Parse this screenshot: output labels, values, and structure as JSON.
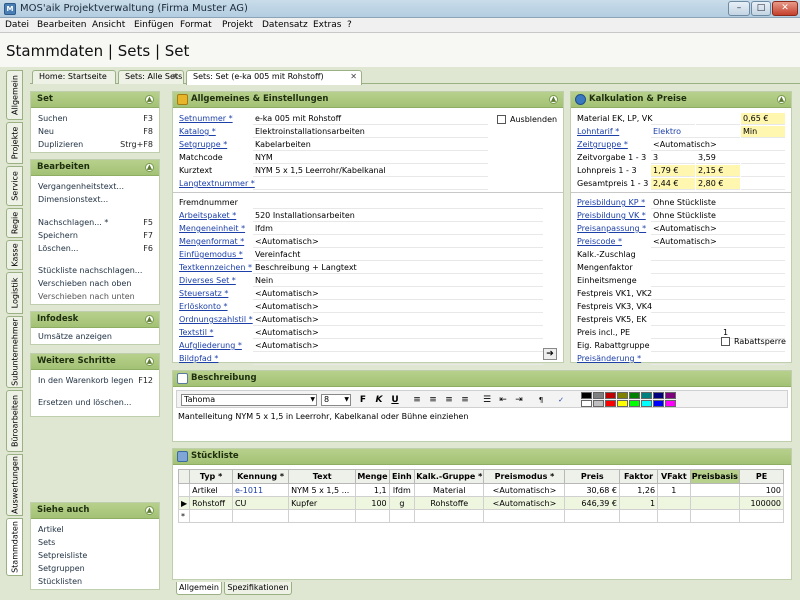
{
  "window": {
    "title": "MOS'aik Projektverwaltung (Firma Muster AG)",
    "min": "–",
    "max": "□",
    "close": "✕"
  },
  "menu": [
    "Datei",
    "Bearbeiten",
    "Ansicht",
    "Einfügen",
    "Format",
    "Projekt",
    "Datensatz",
    "Extras",
    "?"
  ],
  "header": {
    "title": "Stammdaten | Sets | Set"
  },
  "tabs": [
    {
      "label": "Home: Startseite"
    },
    {
      "label": "Sets: Alle Sets"
    },
    {
      "label": "Sets: Set (e-ka 005 mit Rohstoff)"
    }
  ],
  "vtabs": [
    "Allgemein",
    "Projekte",
    "Service",
    "Regie",
    "Kasse",
    "Logistik",
    "Subunternehmer",
    "Büroarbeiten",
    "Auswertungen",
    "Stammdaten"
  ],
  "sidebar": {
    "set": {
      "title": "Set",
      "items": [
        {
          "label": "Suchen",
          "key": "F3"
        },
        {
          "label": "Neu",
          "key": "F8"
        },
        {
          "label": "Duplizieren",
          "key": "Strg+F8"
        }
      ]
    },
    "bearbeiten": {
      "title": "Bearbeiten",
      "items": [
        {
          "label": "Vergangenheitstext...",
          "key": ""
        },
        {
          "label": "Dimensionstext...",
          "key": ""
        },
        {
          "label": "Nachschlagen... *",
          "key": "F5"
        },
        {
          "label": "Speichern",
          "key": "F7"
        },
        {
          "label": "Löschen...",
          "key": "F6"
        },
        {
          "label": "Stückliste nachschlagen...",
          "key": ""
        },
        {
          "label": "Verschieben nach oben",
          "key": ""
        },
        {
          "label": "Verschieben nach unten",
          "key": ""
        }
      ]
    },
    "infodesk": {
      "title": "Infodesk",
      "items": [
        {
          "label": "Umsätze anzeigen"
        }
      ]
    },
    "weitere": {
      "title": "Weitere Schritte",
      "items": [
        {
          "label": "In den Warenkorb legen",
          "key": "F12"
        },
        {
          "label": "Ersetzen und löschen...",
          "key": ""
        }
      ]
    },
    "siehe": {
      "title": "Siehe auch",
      "items": [
        "Artikel",
        "Sets",
        "Setpreisliste",
        "Setgruppen",
        "Stücklisten"
      ]
    }
  },
  "allgemeines": {
    "title": "Allgemeines & Einstellungen",
    "ausblenden": "Ausblenden",
    "fields1": [
      {
        "label": "Setnummer *",
        "value": "e-ka 005 mit Rohstoff",
        "link": true
      },
      {
        "label": "Katalog *",
        "value": "Elektroinstallationsarbeiten",
        "link": true
      },
      {
        "label": "Setgruppe *",
        "value": "Kabelarbeiten",
        "link": true
      },
      {
        "label": "Matchcode",
        "value": "NYM",
        "link": false
      },
      {
        "label": "Kurztext",
        "value": "NYM 5 x 1,5 Leerrohr/Kabelkanal",
        "link": false
      },
      {
        "label": "Langtextnummer *",
        "value": "",
        "link": true
      }
    ],
    "fields2": [
      {
        "label": "Fremdnummer",
        "value": "",
        "link": false
      },
      {
        "label": "Arbeitspaket *",
        "value": "520 Installationsarbeiten",
        "link": true
      },
      {
        "label": "Mengeneinheit *",
        "value": "lfdm",
        "link": true
      },
      {
        "label": "Mengenformat *",
        "value": "<Automatisch>",
        "link": true
      },
      {
        "label": "Einfügemodus *",
        "value": "Vereinfacht",
        "link": true
      },
      {
        "label": "Textkennzeichen *",
        "value": "Beschreibung + Langtext",
        "link": true
      },
      {
        "label": "Diverses Set *",
        "value": "Nein",
        "link": true
      },
      {
        "label": "Steuersatz *",
        "value": "<Automatisch>",
        "link": true
      },
      {
        "label": "Erlöskonto *",
        "value": "<Automatisch>",
        "link": true
      },
      {
        "label": "Ordnungszahlstil *",
        "value": "<Automatisch>",
        "link": true
      },
      {
        "label": "Textstil *",
        "value": "<Automatisch>",
        "link": true
      },
      {
        "label": "Aufgliederung *",
        "value": "<Automatisch>",
        "link": true
      },
      {
        "label": "Bildpfad *",
        "value": "",
        "link": true
      }
    ]
  },
  "kalkulation": {
    "title": "Kalkulation & Preise",
    "row_material": {
      "label": "Material EK, LP, VK",
      "v3": "0,65 €"
    },
    "row_lohntarif": {
      "label": "Lohntarif *",
      "v1": "Elektro",
      "v2": "Min"
    },
    "row_zeitgruppe": {
      "label": "Zeitgruppe *",
      "v1": "<Automatisch>"
    },
    "row_zeitvorgabe": {
      "label": "Zeitvorgabe 1 - 3",
      "v1": "3",
      "v2": "3,59"
    },
    "row_lohnpreis": {
      "label": "Lohnpreis 1 - 3",
      "v1": "1,79 €",
      "v2": "2,15 €"
    },
    "row_gesamtpreis": {
      "label": "Gesamtpreis 1 - 3",
      "v1": "2,44 €",
      "v2": "2,80 €"
    },
    "fields2": [
      {
        "label": "Preisbildung KP *",
        "value": "Ohne Stückliste",
        "link": true
      },
      {
        "label": "Preisbildung VK *",
        "value": "Ohne Stückliste",
        "link": true
      },
      {
        "label": "Preisanpassung *",
        "value": "<Automatisch>",
        "link": true
      },
      {
        "label": "Preiscode *",
        "value": "<Automatisch>",
        "link": true
      },
      {
        "label": "Kalk.-Zuschlag",
        "value": "",
        "link": false
      },
      {
        "label": "Mengenfaktor",
        "value": "",
        "link": false
      },
      {
        "label": "Einheitsmenge",
        "value": "",
        "link": false
      },
      {
        "label": "Festpreis VK1, VK2",
        "value": "",
        "link": false
      },
      {
        "label": "Festpreis VK3, VK4",
        "value": "",
        "link": false
      },
      {
        "label": "Festpreis VK5, EK",
        "value": "",
        "link": false
      },
      {
        "label": "Preis incl., PE",
        "value": "",
        "value2": "1",
        "link": false
      },
      {
        "label": "Eig. Rabattgruppe",
        "value": "",
        "link": false
      },
      {
        "label": "Preisänderung *",
        "value": "",
        "link": true
      }
    ],
    "rabattsperre": "Rabattsperre"
  },
  "beschreibung": {
    "title": "Beschreibung",
    "font": "Tahoma",
    "size": "8",
    "text": "Mantelleitung NYM 5 x 1,5 in Leerrohr, Kabelkanal oder Bühne einziehen",
    "palette": [
      "#000000",
      "#7f7f7f",
      "#c00000",
      "#7f7f00",
      "#007f00",
      "#007f7f",
      "#00007f",
      "#7f007f",
      "#ffffff",
      "#c0c0c0",
      "#ff0000",
      "#ffff00",
      "#00ff00",
      "#00ffff",
      "#0000ff",
      "#ff00ff"
    ]
  },
  "stueckliste": {
    "title": "Stückliste",
    "columns": [
      "Typ *",
      "Kennung *",
      "Text",
      "Menge",
      "Einh",
      "Kalk.-Gruppe *",
      "Preismodus *",
      "Preis",
      "Faktor",
      "VFakt",
      "Preisbasis",
      "PE"
    ],
    "rows": [
      [
        "Artikel",
        "e-1011",
        "NYM 5 x 1,5 ...",
        "1,1",
        "lfdm",
        "Material",
        "<Automatisch>",
        "30,68 €",
        "1,26",
        "1",
        "",
        "100"
      ],
      [
        "Rohstoff",
        "CU",
        "Kupfer",
        "100",
        "g",
        "Rohstoffe",
        "<Automatisch>",
        "646,39 €",
        "1",
        "",
        "",
        "100000"
      ]
    ],
    "newrow": "*",
    "current": "▶"
  },
  "bottomtabs": [
    "Allgemein",
    "Spezifikationen"
  ]
}
